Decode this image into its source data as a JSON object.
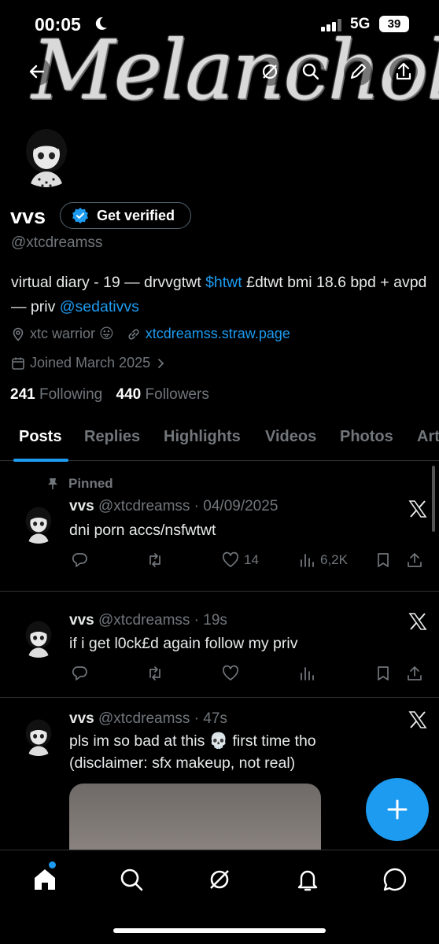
{
  "status_bar": {
    "time": "00:05",
    "network": "5G",
    "battery": "39"
  },
  "banner": {
    "title": "Melancholy"
  },
  "profile": {
    "name": "vvs",
    "verify_label": "Get verified",
    "handle": "@xtcdreamss",
    "bio_part1": "virtual diary - 19 — drvvgtwt ",
    "bio_tag": "$htwt",
    "bio_part2": " £dtwt bmi 18.6 bpd + avpd — priv ",
    "bio_mention": "@sedativvs",
    "location": "xtc warrior 😛",
    "website": "xtcdreamss.straw.page",
    "joined": "Joined March 2025",
    "following_count": "241",
    "following_label": "Following",
    "followers_count": "440",
    "followers_label": "Followers"
  },
  "tabs": [
    "Posts",
    "Replies",
    "Highlights",
    "Videos",
    "Photos",
    "Art"
  ],
  "posts": [
    {
      "pinned_label": "Pinned",
      "name": "vvs",
      "meta": "@xtcdreamss · 04/09/2025",
      "text": "dni porn accs/nsfwtwt",
      "likes": "14",
      "views": "6,2K"
    },
    {
      "name": "vvs",
      "meta": "@xtcdreamss · 19s",
      "text": "if i get l0ck£d again follow my priv"
    },
    {
      "name": "vvs",
      "meta": "@xtcdreamss · 47s",
      "text_line1": "pls im so bad at this 💀 first time tho",
      "text_line2": "(disclaimer: sfx makeup, not real)"
    }
  ],
  "colors": {
    "accent": "#1d9bf0",
    "muted": "#71767b",
    "divider": "#2f3336"
  }
}
